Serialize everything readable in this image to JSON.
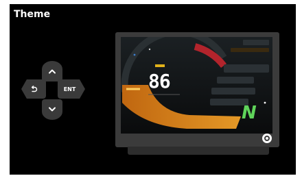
{
  "page": {
    "title": "Theme"
  },
  "dpad": {
    "ok_label": "ENT",
    "up_icon": "chevron-up-icon",
    "down_icon": "chevron-down-icon",
    "back_icon": "back-arrow-icon"
  },
  "preview": {
    "speed": "86",
    "gear": "N",
    "selected": true
  },
  "colors": {
    "background": "#000000",
    "key": "#3a3a3a",
    "device": "#3b3b3b",
    "gauge_orange": "#e08c1a",
    "gauge_red": "#b2242c",
    "gear_green": "#5fd35a",
    "accent_yellow": "#e2b21a"
  }
}
